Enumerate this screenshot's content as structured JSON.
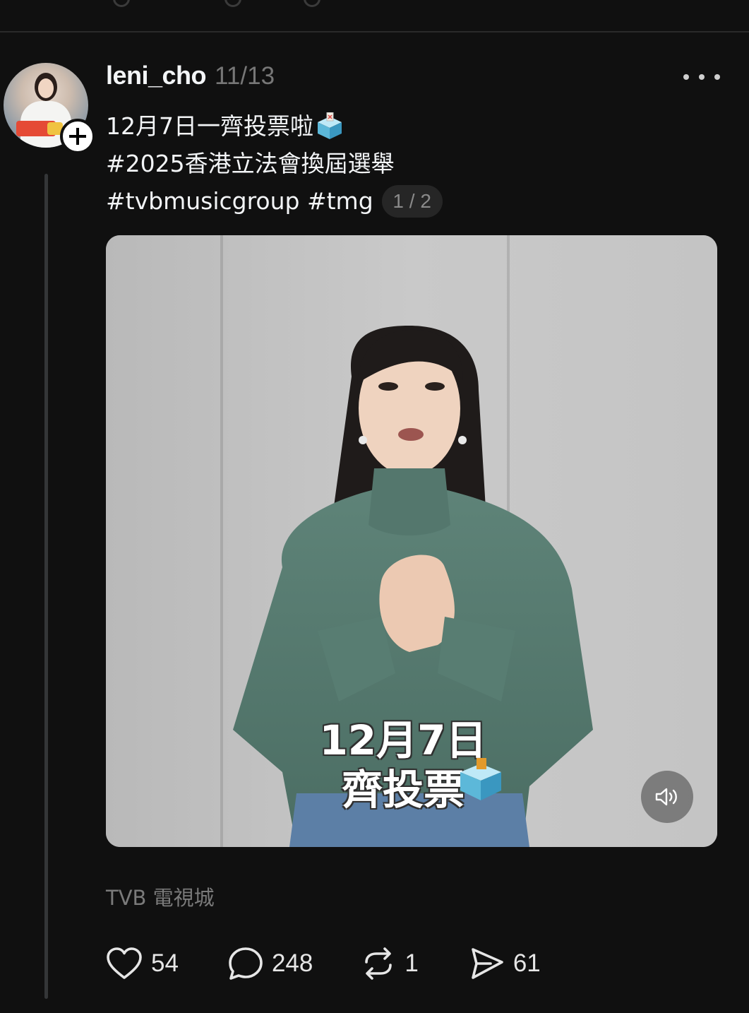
{
  "post": {
    "username": "leni_cho",
    "date": "11/13",
    "caption_line1": "12月7日一齊投票啦",
    "caption_line2": "#2025香港立法會換屆選舉",
    "caption_line3": "#tvbmusicgroup #tmg",
    "media_page": "1 / 2",
    "video_overlay_line1": "12月7日",
    "video_overlay_line2": "齊投票",
    "location": "TVB 電視城",
    "likes": "54",
    "replies": "248",
    "reposts": "1",
    "shares": "61"
  },
  "icons": {
    "more": "more-horizontal-icon",
    "follow": "plus-icon",
    "ballot": "ballot-box-emoji",
    "mute": "speaker-icon",
    "like": "heart-icon",
    "reply": "comment-icon",
    "repost": "repost-icon",
    "share": "send-icon"
  },
  "colors": {
    "background": "#101010",
    "text": "#f3f5f7",
    "muted": "#777777"
  }
}
